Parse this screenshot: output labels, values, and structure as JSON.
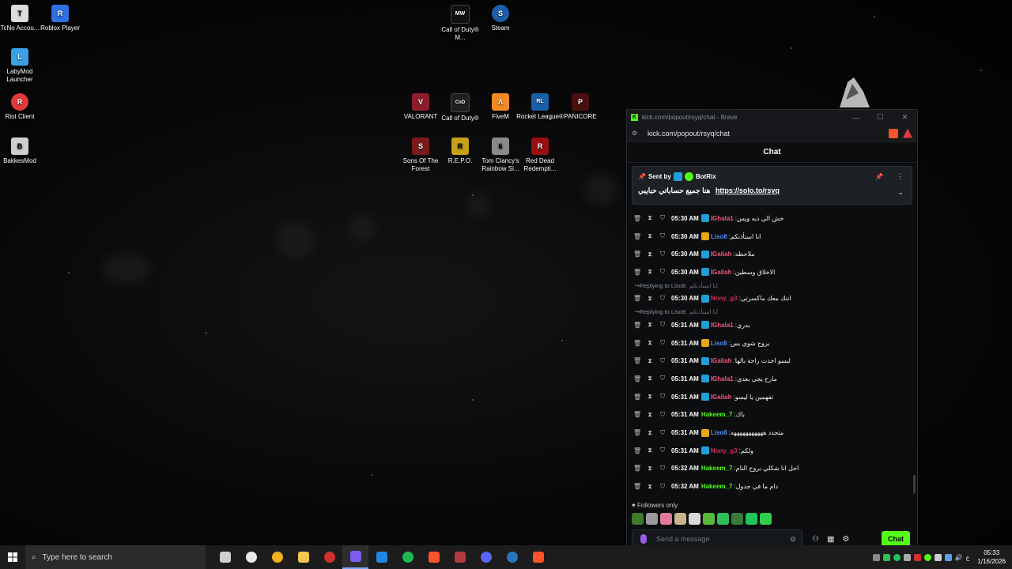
{
  "desktop": {
    "icons": [
      {
        "label": "TcNo Accou...",
        "color": "#dcdcdc",
        "glyph": "T"
      },
      {
        "label": "Roblox Player",
        "color": "#2f6fe0",
        "glyph": "R"
      },
      {
        "label": "LabyMod Launcher",
        "color": "#3aa0e8",
        "glyph": "L"
      },
      {
        "label": "Riot Client",
        "color": "#e03a3a",
        "glyph": "R"
      },
      {
        "label": "BakkesMod",
        "color": "#cfcfcf",
        "glyph": "B"
      },
      {
        "label": "Call of Duty® M...",
        "color": "#111111",
        "glyph": "MW"
      },
      {
        "label": "Steam",
        "color": "#1b5fa8",
        "glyph": "S"
      },
      {
        "label": "VALORANT",
        "color": "#8e1d2c",
        "glyph": "V"
      },
      {
        "label": "Call of Duty®",
        "color": "#202020",
        "glyph": "CoD"
      },
      {
        "label": "FiveM",
        "color": "#f08a24",
        "glyph": "Λ"
      },
      {
        "label": "Rocket League®",
        "color": "#1b5fa8",
        "glyph": "RL"
      },
      {
        "label": "PANICORE",
        "color": "#4a1010",
        "glyph": "P"
      },
      {
        "label": "Sons Of The Forest",
        "color": "#7a1a1a",
        "glyph": "S"
      },
      {
        "label": "R.E.P.O.",
        "color": "#c7a01a",
        "glyph": "R"
      },
      {
        "label": "Tom Clancy's Rainbow Si...",
        "color": "#8a8a8a",
        "glyph": "6"
      },
      {
        "label": "Red Dead Redempti...",
        "color": "#9a1010",
        "glyph": "R"
      }
    ]
  },
  "browser": {
    "title": "kick.com/popout/rsyq/chat - Brave",
    "url": "kick.com/popout/rsyq/chat",
    "minimize": "—",
    "maximize": "☐",
    "close": "✕"
  },
  "chat": {
    "header": "Chat",
    "pinned": {
      "sent_by": "Sent by",
      "sender": "BotRix",
      "text": "هنا جميع حساباتي حبايبي",
      "link": "https://solo.to/rsyq"
    },
    "messages": [
      {
        "type": "msg",
        "time": "05:30 AM",
        "user": "IGhala1",
        "color": "#f25a7a",
        "badge": "bot",
        "text": "خش الي ذيه ويس"
      },
      {
        "type": "msg",
        "time": "05:30 AM",
        "user": "Liso8",
        "color": "#4d8cf5",
        "badge": "crown",
        "text": "انا استأذنكم"
      },
      {
        "type": "msg",
        "time": "05:30 AM",
        "user": "IGaliah",
        "color": "#f25a7a",
        "badge": "bot",
        "text": "ملاحظه"
      },
      {
        "type": "msg",
        "time": "05:30 AM",
        "user": "IGaliah",
        "color": "#f25a7a",
        "badge": "bot",
        "text": "الاخلاق وسطين"
      },
      {
        "type": "reply",
        "text": "Replying to Liso8:",
        "quote": "انا استأذنكم"
      },
      {
        "type": "msg",
        "time": "05:30 AM",
        "user": "Nony_g3",
        "color": "#c8305a",
        "badge": "bot",
        "text": "انتك معك ماكسرتي"
      },
      {
        "type": "reply",
        "text": "Replying to Liso8:",
        "quote": "انا استأذنكم"
      },
      {
        "type": "msg",
        "time": "05:31 AM",
        "user": "IGhala1",
        "color": "#f25a7a",
        "badge": "bot",
        "text": "بدري"
      },
      {
        "type": "msg",
        "time": "05:31 AM",
        "user": "Liso8",
        "color": "#4d8cf5",
        "badge": "crown",
        "text": "بروح شوي بس"
      },
      {
        "type": "msg",
        "time": "05:31 AM",
        "user": "IGaliah",
        "color": "#f25a7a",
        "badge": "bot",
        "text": "ليسو اخذت راحة بالها"
      },
      {
        "type": "msg",
        "time": "05:31 AM",
        "user": "IGhala1",
        "color": "#f25a7a",
        "badge": "bot",
        "text": "مارح يجي بعدي"
      },
      {
        "type": "msg",
        "time": "05:31 AM",
        "user": "IGaliah",
        "color": "#f25a7a",
        "badge": "bot",
        "text": "تفهمين يا ليسو"
      },
      {
        "type": "msg",
        "time": "05:31 AM",
        "user": "Hakeem_7",
        "color": "#53fc18",
        "badge": "none",
        "text": "باك"
      },
      {
        "type": "msg",
        "time": "05:31 AM",
        "user": "Liso8",
        "color": "#4d8cf5",
        "badge": "crown",
        "text": "متجدد هههههههههههه"
      },
      {
        "type": "msg",
        "time": "05:31 AM",
        "user": "Nony_g3",
        "color": "#c8305a",
        "badge": "bot",
        "text": "ولكم"
      },
      {
        "type": "msg",
        "time": "05:32 AM",
        "user": "Hakeem_7",
        "color": "#53fc18",
        "badge": "none",
        "text": "اجل انا شكلي بروح النام"
      },
      {
        "type": "msg",
        "time": "05:32 AM",
        "user": "Hakeem_7",
        "color": "#53fc18",
        "badge": "none",
        "text": "دام ما في جدول"
      }
    ],
    "followers_only": "Followers only",
    "emote_colors": [
      "#3d7a2a",
      "#9a9a9a",
      "#e07a9a",
      "#c9b38a",
      "#d8d8d8",
      "#5ab83a",
      "#2fbf5a",
      "#3a7a3a",
      "#22c45a",
      "#2fcf4a"
    ],
    "input_placeholder": "Send a message",
    "send_label": "Chat"
  },
  "taskbar": {
    "search_placeholder": "Type here to search",
    "apps": [
      {
        "name": "task-view",
        "color": "#cfcfcf"
      },
      {
        "name": "steelseries",
        "color": "#e8e8e8"
      },
      {
        "name": "chrome",
        "color": "#f2b01e"
      },
      {
        "name": "file-explorer",
        "color": "#f2c94c"
      },
      {
        "name": "app-red",
        "color": "#d03030"
      },
      {
        "name": "discord-ptb",
        "color": "#7d5cf0"
      },
      {
        "name": "app-blue",
        "color": "#1e88e5"
      },
      {
        "name": "spotify",
        "color": "#1db954"
      },
      {
        "name": "brave",
        "color": "#fb542b"
      },
      {
        "name": "app-game",
        "color": "#b33b3b"
      },
      {
        "name": "discord",
        "color": "#5865f2"
      },
      {
        "name": "steam",
        "color": "#2a75bb"
      },
      {
        "name": "brave-kick",
        "color": "#fb542b"
      }
    ],
    "lang": "ع",
    "time": "05:33",
    "date": "1/16/2026"
  }
}
